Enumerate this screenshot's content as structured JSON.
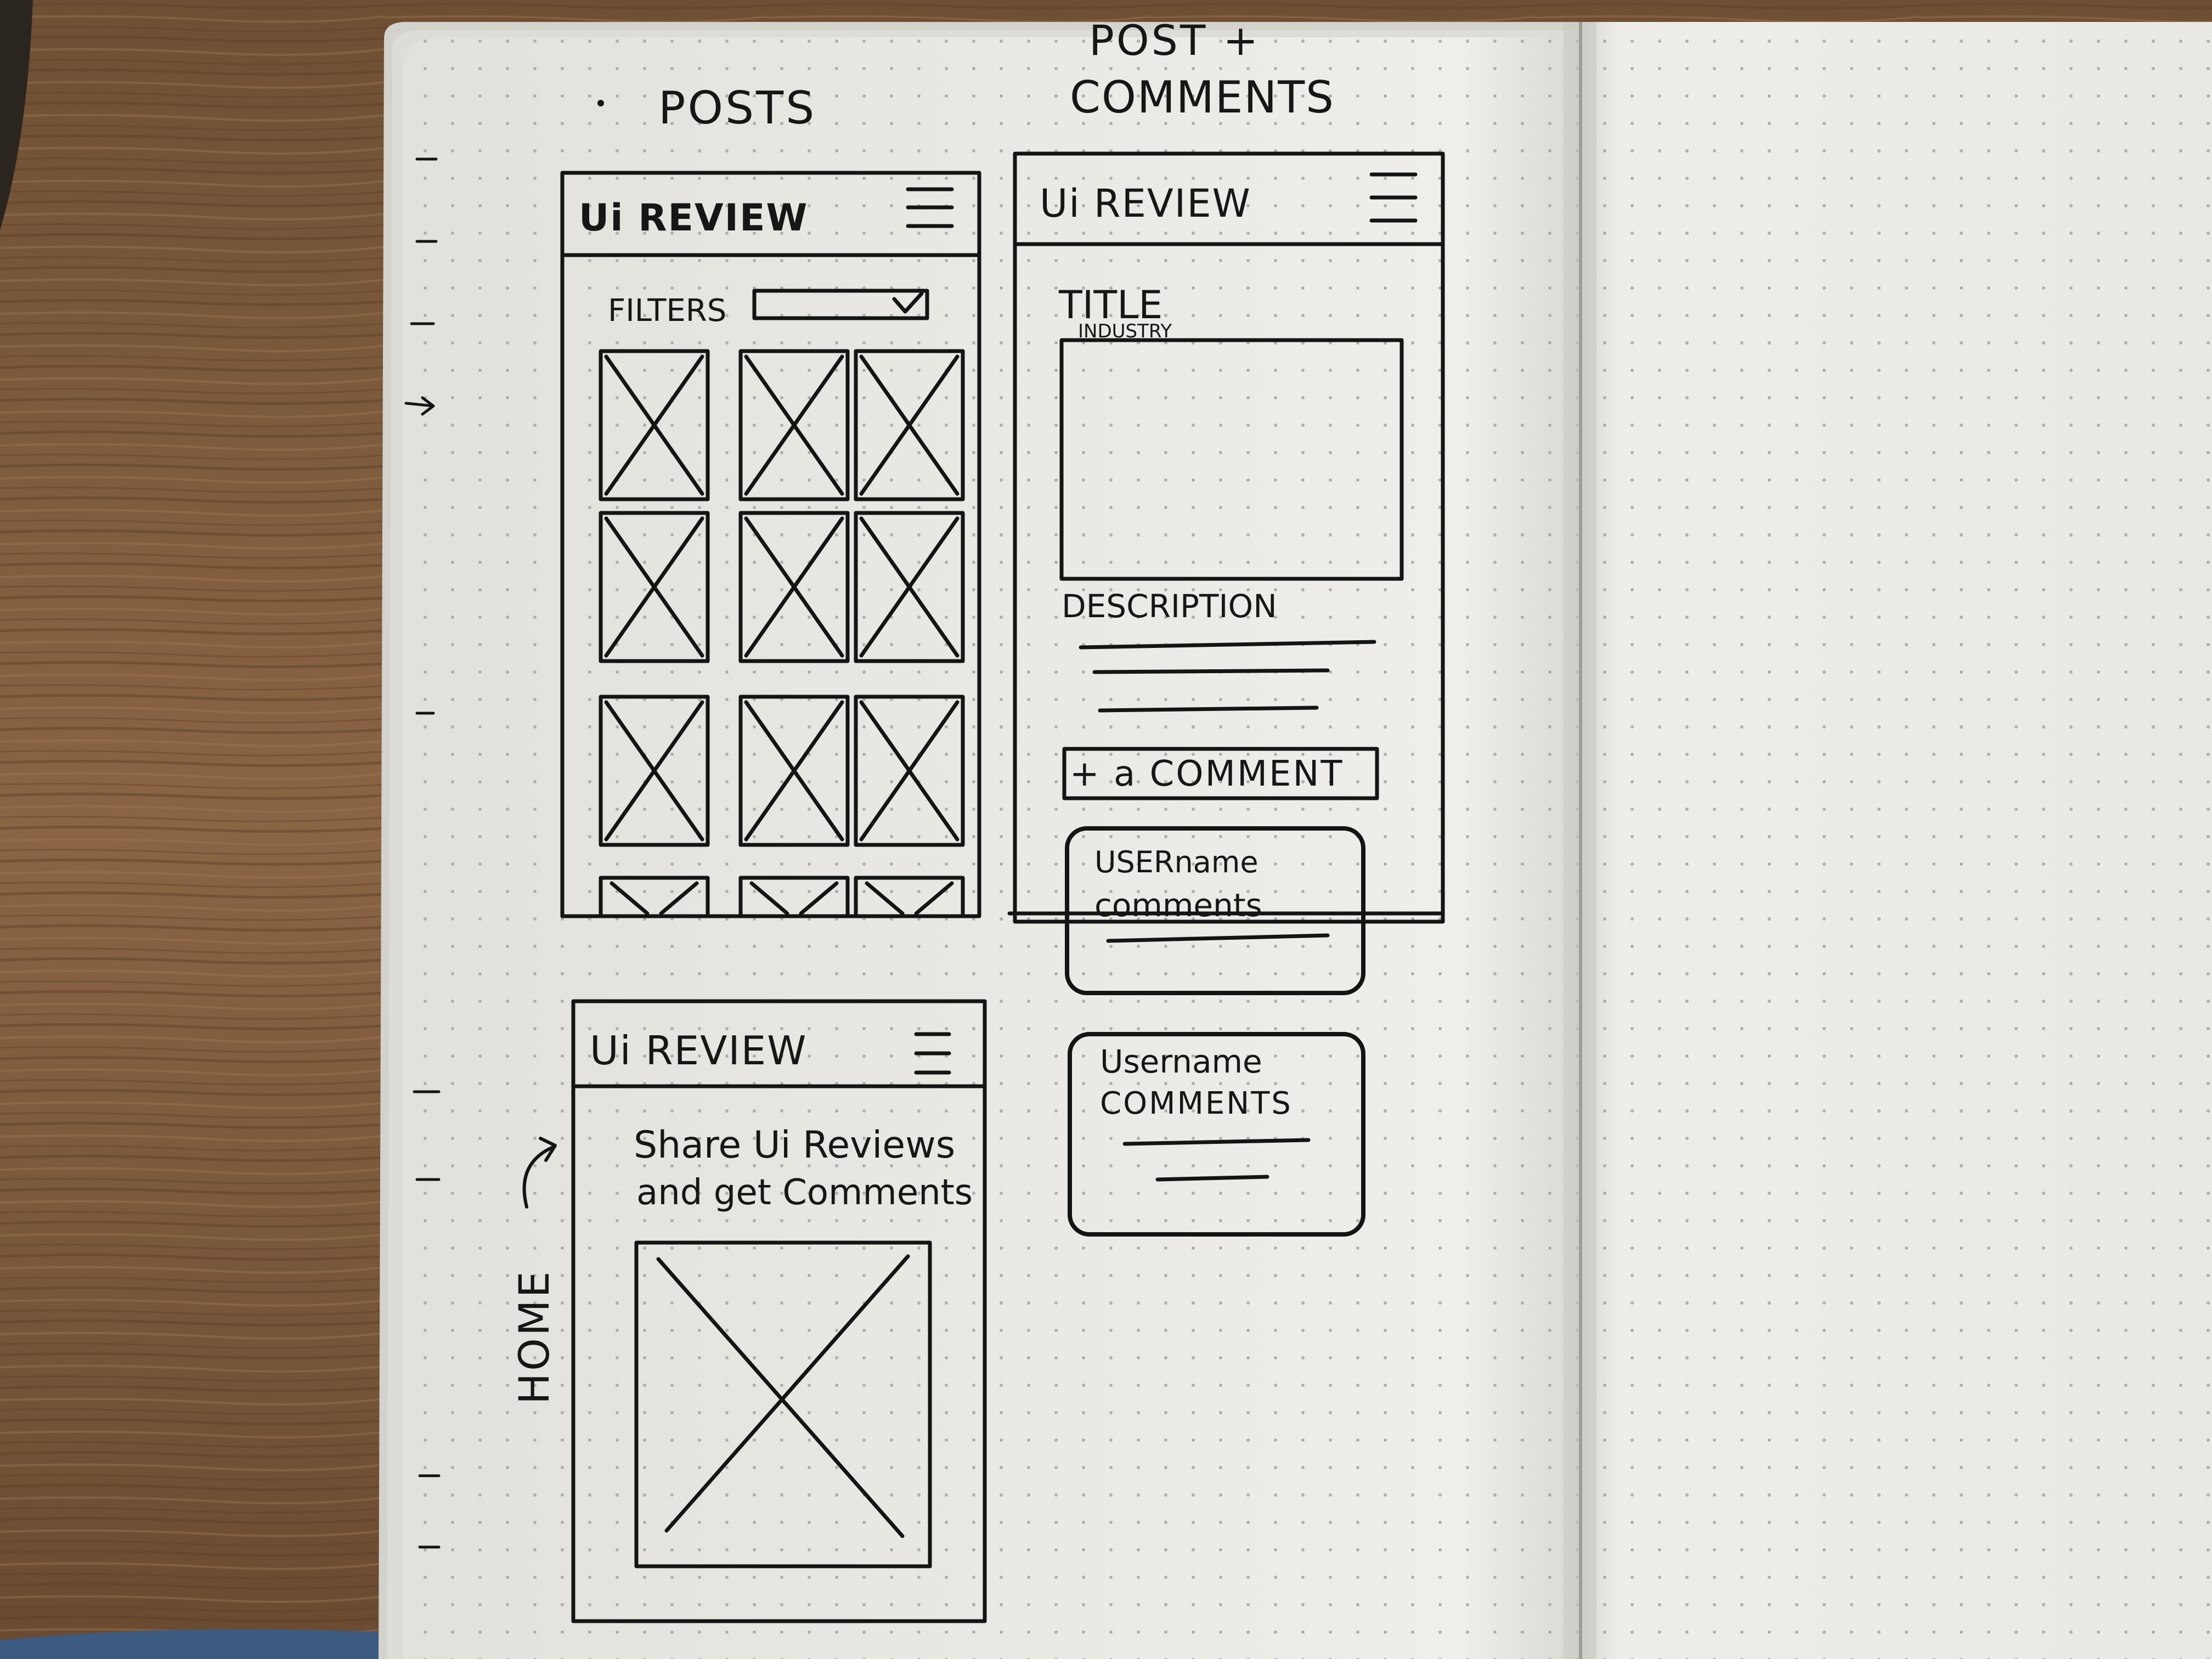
{
  "annotations": {
    "posts_label": "POSTS",
    "post_comments_label_line1": "POST +",
    "post_comments_label_line2": "COMMENTS",
    "home_label": "HOME"
  },
  "posts_screen": {
    "brand": "Ui REVIEW",
    "menu_icon": "hamburger-menu-icon",
    "filters_label": "FILTERS",
    "filter_icon": "checkmark-icon",
    "thumbnail_icon": "image-placeholder-icon"
  },
  "post_screen": {
    "brand": "Ui REVIEW",
    "menu_icon": "hamburger-menu-icon",
    "title_label": "TITLE",
    "industry_label": "INDUSTRY",
    "description_label": "DESCRIPTION",
    "add_comment_label": "+ a COMMENT",
    "comments": [
      {
        "username": "USERname",
        "text": "comments"
      },
      {
        "username": "Username",
        "text": "COMMENTS"
      }
    ]
  },
  "home_screen": {
    "brand": "Ui REVIEW",
    "menu_icon": "hamburger-menu-icon",
    "headline_line1": "Share Ui Reviews",
    "headline_line2": "and get Comments",
    "hero_icon": "image-placeholder-icon"
  },
  "colors": {
    "wood": "#7b5a3c",
    "paper": "#ecebe7",
    "ink": "#141414",
    "jeans": "#3d5a80"
  }
}
